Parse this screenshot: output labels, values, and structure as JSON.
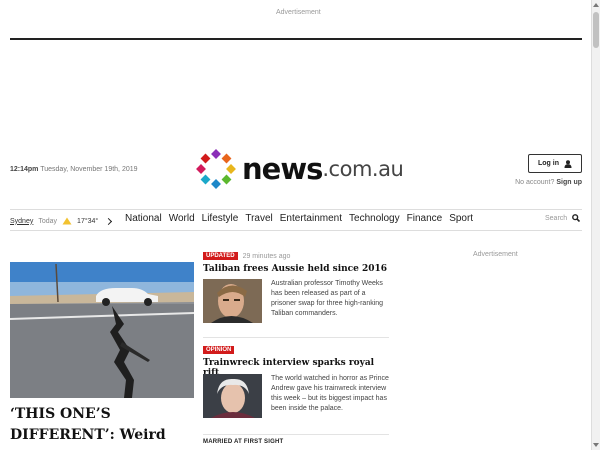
{
  "ads": {
    "top_label": "Advertisement",
    "side_label": "Advertisement"
  },
  "header": {
    "time": "12:14pm",
    "date": "Tuesday, November 19th, 2019",
    "logo_word": "news",
    "logo_tld": ".com.au",
    "login_label": "Log in",
    "no_account_text": "No account?",
    "signup_label": "Sign up"
  },
  "weather": {
    "city": "Sydney",
    "day": "Today",
    "temp": "17°34°"
  },
  "nav": {
    "items": [
      "National",
      "World",
      "Lifestyle",
      "Travel",
      "Entertainment",
      "Technology",
      "Finance",
      "Sport"
    ]
  },
  "search": {
    "label": "Search"
  },
  "hero": {
    "headline": "‘THIS ONE’S DIFFERENT’: Weird"
  },
  "stories": [
    {
      "badge": "Updated",
      "ago": "29 minutes ago",
      "title": "Taliban frees Aussie held since 2016",
      "summary": "Australian professor Timothy Weeks has been released as part of a prisoner swap for three high-ranking Taliban commanders."
    },
    {
      "badge": "Opinion",
      "title": "Trainwreck interview sparks royal rift",
      "summary": "The world watched in horror as Prince Andrew gave his trainwreck interview this week – but its biggest impact has been inside the palace."
    }
  ],
  "next_section_label": "MARRIED AT FIRST SIGHT",
  "colors": {
    "badge_red": "#d21b1b",
    "logo_text": "#111111"
  }
}
